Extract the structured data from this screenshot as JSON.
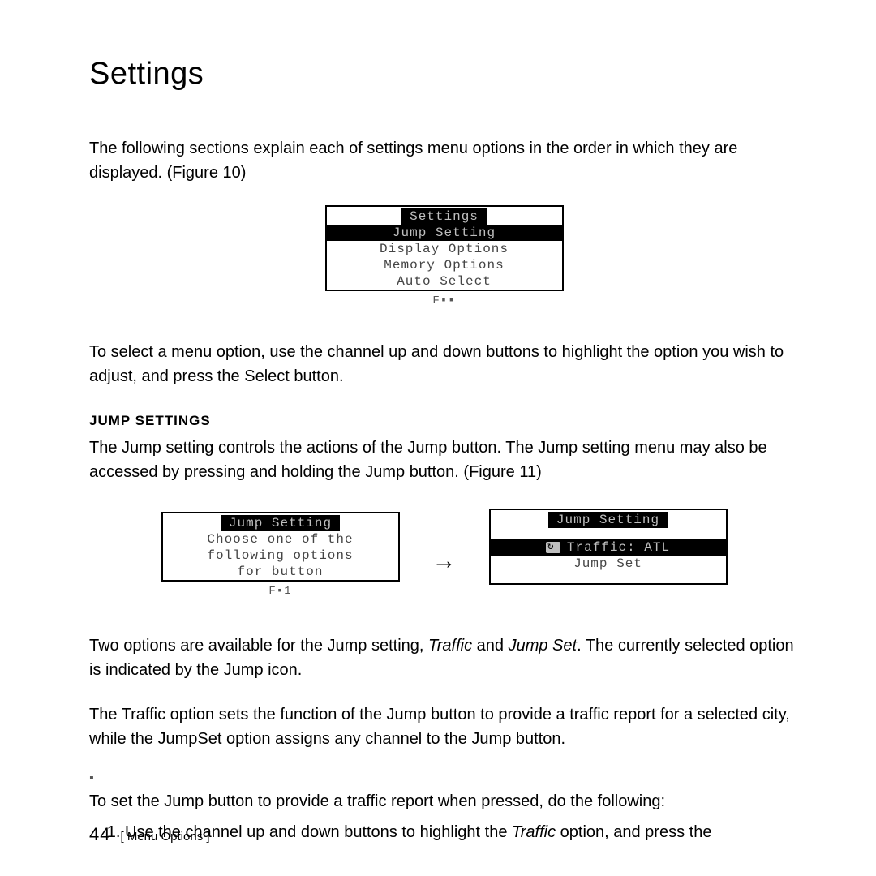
{
  "title": "Settings",
  "intro": "The following sections explain each of settings menu options in the order in which they are displayed. (Figure 10)",
  "fig10": {
    "header": "Settings",
    "rows": [
      "Jump Setting",
      "Display Options",
      "Memory Options",
      "Auto Select"
    ],
    "selected_index": 0,
    "caption_glyph": "F▪▪"
  },
  "select_help": "To select a menu option, use the channel up and down buttons to highlight the option you wish to adjust, and press the Select button.",
  "jump_settings_head": "JUMP SETTINGS",
  "jump_settings_body": "The Jump setting controls the actions of the Jump button. The Jump setting menu may also be accessed by pressing and holding the Jump button. (Figure 11)",
  "fig11": {
    "left": {
      "header": "Jump Setting",
      "lines": [
        "Choose one of the",
        "following options",
        "for   button"
      ]
    },
    "right": {
      "header": "Jump Setting",
      "selected": "Traffic: ATL",
      "other": "Jump Set",
      "icon_name": "jump-icon"
    },
    "caption_glyph": "F▪1"
  },
  "two_options_a": "Two options are available for the Jump setting, ",
  "two_options_traffic": "Traffic",
  "two_options_b": " and ",
  "two_options_jumpset": "Jump Set",
  "two_options_c": ". The currently selected option is indicated by the Jump icon.",
  "traffic_explain": "The Traffic option sets the function of the Jump button to provide a traffic report for a selected city, while the JumpSet option assigns any channel to the Jump button.",
  "lone_glyph": "▪",
  "howto_intro": "To set the Jump button to provide a traffic report when pressed, do the following:",
  "step1_a": "Use the channel up and down buttons to highlight the ",
  "step1_traffic": "Traffic",
  "step1_b": " option, and press the",
  "footer": {
    "pagenum": "44",
    "section": "[ Menu Options ]"
  }
}
